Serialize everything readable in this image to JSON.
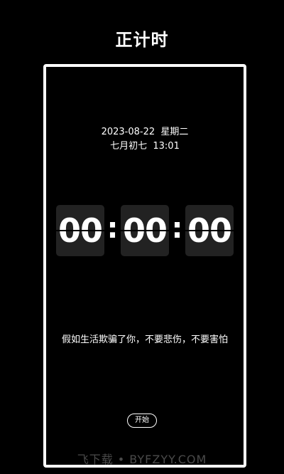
{
  "header": {
    "title": "正计时"
  },
  "datetime": {
    "date_line": "2023-08-22  星期二",
    "lunar_time_line": "七月初七  13:01"
  },
  "timer": {
    "hours": "00",
    "minutes": "00",
    "seconds": "00",
    "separator": ":"
  },
  "quote": {
    "text": "假如生活欺骗了你，不要悲伤，不要害怕"
  },
  "controls": {
    "start_label": "开始"
  },
  "watermark": {
    "text": "飞下载 • BYFZYY.COM"
  },
  "colors": {
    "background": "#000000",
    "text": "#ffffff",
    "digit_tile": "#222222",
    "watermark": "#4a4a4a"
  }
}
